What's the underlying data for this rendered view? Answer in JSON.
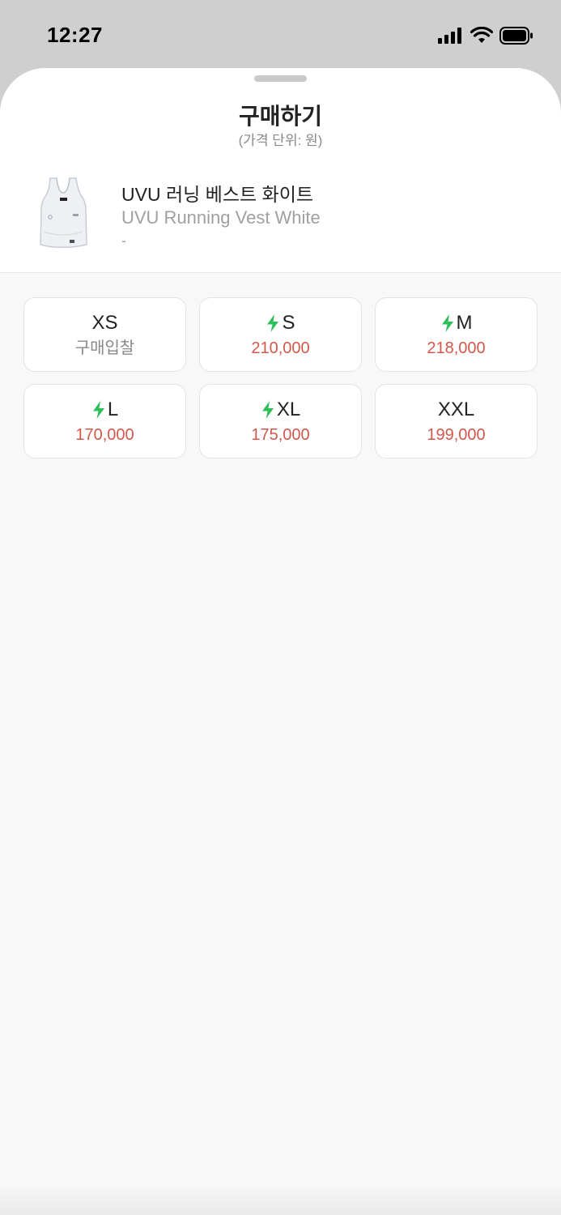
{
  "status": {
    "time": "12:27"
  },
  "sheet": {
    "title": "구매하기",
    "subtitle": "(가격 단위: 원)"
  },
  "product": {
    "name_ko": "UVU 러닝 베스트 화이트",
    "name_en": "UVU Running Vest White",
    "extra": "-"
  },
  "sizes": [
    {
      "label": "XS",
      "price": "구매입찰",
      "fast": false,
      "price_is_bid": true
    },
    {
      "label": "S",
      "price": "210,000",
      "fast": true
    },
    {
      "label": "M",
      "price": "218,000",
      "fast": true
    },
    {
      "label": "L",
      "price": "170,000",
      "fast": true
    },
    {
      "label": "XL",
      "price": "175,000",
      "fast": true
    },
    {
      "label": "XXL",
      "price": "199,000",
      "fast": false
    }
  ],
  "colors": {
    "price": "#d1584a",
    "bolt": "#2fbf5a"
  },
  "icons": [
    "signal-icon",
    "wifi-icon",
    "battery-icon",
    "bolt-icon"
  ]
}
